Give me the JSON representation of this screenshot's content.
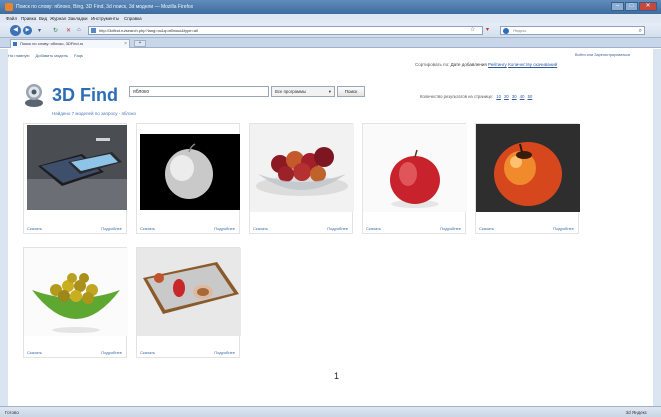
{
  "window": {
    "title": "Поиск по слову: яблоко, Bing, 3D Find, 3d поиск, 3d модели — Mozilla Firefox"
  },
  "menubar": {
    "items": [
      "Файл",
      "Правка",
      "Вид",
      "Журнал",
      "Закладки",
      "Инструменты",
      "Справка"
    ]
  },
  "navbar": {
    "url": "http://3dfind.ru/search.php?lang=ru&q=яблоко&type=all",
    "search_placeholder": "Яндекс"
  },
  "tab": {
    "label": "Поиск по слову: яблоко, 3DFind.ru"
  },
  "page": {
    "top_links": [
      "На главную",
      "Добавить модель",
      "Faqs"
    ],
    "user_link": "Войти или Зарегистрироваться",
    "sort_label": "Сортировать по:",
    "sort_current": "Дате добавления",
    "sort_options": [
      "Рейтингу",
      "Количеству скачиваний"
    ],
    "per_page_label": "Количество результатов на странице:",
    "per_page_options": [
      "10",
      "20",
      "30",
      "40",
      "50"
    ],
    "logo_text": "3D Find",
    "query_value": "яблоко",
    "program_select": "Все программы",
    "search_button": "Поиск",
    "found_text": "Найдено 7 моделей по запросу - яблоко",
    "pagination": "1"
  },
  "results": [
    {
      "download": "Скачать",
      "more": "Подробнее",
      "scene": "iphone"
    },
    {
      "download": "Скачать",
      "more": "Подробнее",
      "scene": "white-apple"
    },
    {
      "download": "Скачать",
      "more": "Подробнее",
      "scene": "fruit-bowl"
    },
    {
      "download": "Скачать",
      "more": "Подробнее",
      "scene": "red-apple"
    },
    {
      "download": "Скачать",
      "more": "Подробнее",
      "scene": "orange-apple"
    },
    {
      "download": "Скачать",
      "more": "Подробнее",
      "scene": "green-bowl"
    },
    {
      "download": "Скачать",
      "more": "Подробнее",
      "scene": "tray"
    }
  ],
  "statusbar": {
    "left": "Готово",
    "right": "3d Яндекс"
  },
  "colors": {
    "accent": "#2b6db6",
    "link": "#3a6aa8"
  }
}
